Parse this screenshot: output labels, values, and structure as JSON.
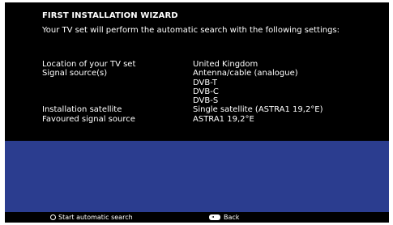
{
  "wizard": {
    "title": "FIRST INSTALLATION WIZARD",
    "subtitle": "Your TV set will perform the automatic search with the following settings:"
  },
  "settings": [
    {
      "label": "Location of your TV set",
      "value": "United Kingdom"
    },
    {
      "label": "Signal source(s)",
      "value": "Antenna/cable (analogue)"
    },
    {
      "label": "",
      "value": "DVB-T"
    },
    {
      "label": "",
      "value": "DVB-C"
    },
    {
      "label": "",
      "value": "DVB-S"
    },
    {
      "label": "Installation satellite",
      "value": "Single satellite (ASTRA1 19,2°E)"
    },
    {
      "label": "Favoured signal source",
      "value": "ASTRA1 19,2°E"
    }
  ],
  "footer": {
    "start_label": "Start automatic search",
    "back_label": "Back"
  },
  "colors": {
    "screen_background": "#000000",
    "panel_blue": "#2b3d8f",
    "text": "#ffffff"
  },
  "icons": {
    "start": "ok-button-icon",
    "back": "back-button-icon"
  }
}
